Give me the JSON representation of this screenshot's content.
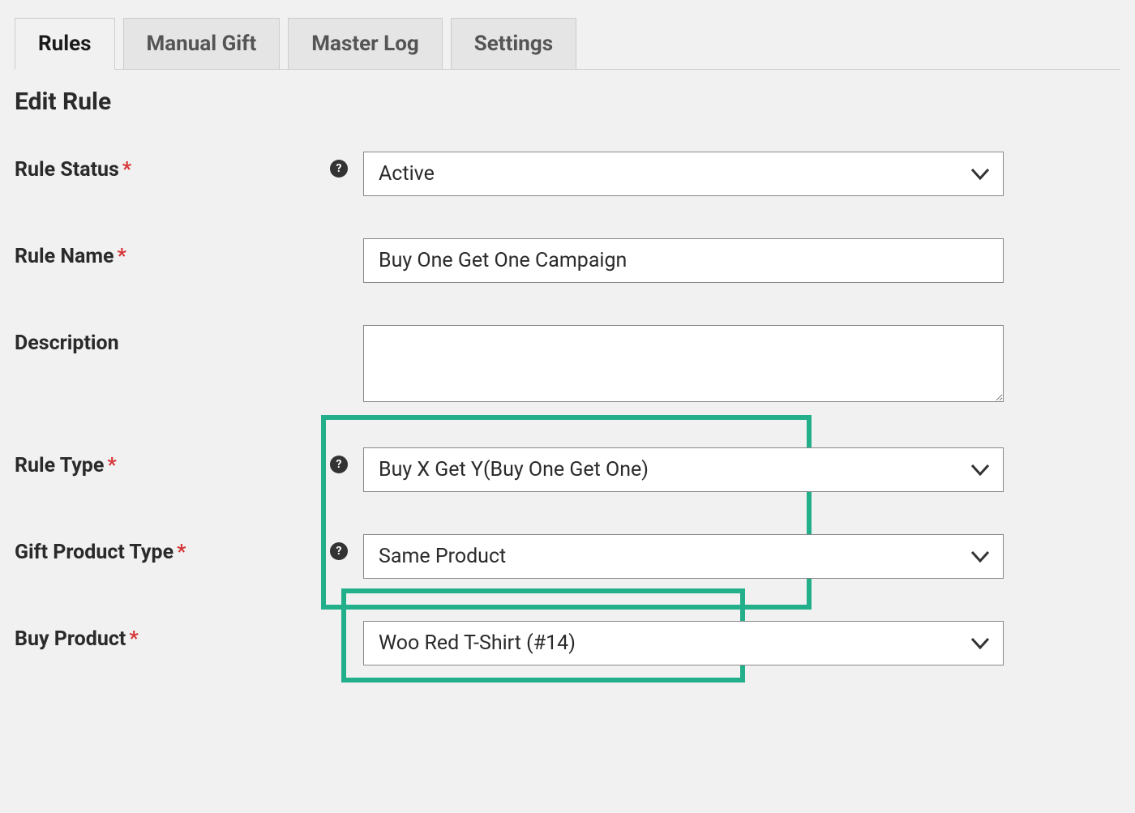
{
  "tabs": {
    "items": [
      {
        "label": "Rules",
        "active": true
      },
      {
        "label": "Manual Gift",
        "active": false
      },
      {
        "label": "Master Log",
        "active": false
      },
      {
        "label": "Settings",
        "active": false
      }
    ]
  },
  "heading": "Edit Rule",
  "form": {
    "rule_status": {
      "label": "Rule Status",
      "required": true,
      "has_help": true,
      "value": "Active"
    },
    "rule_name": {
      "label": "Rule Name",
      "required": true,
      "has_help": false,
      "value": "Buy One Get One Campaign"
    },
    "description": {
      "label": "Description",
      "required": false,
      "has_help": false,
      "value": ""
    },
    "rule_type": {
      "label": "Rule Type",
      "required": true,
      "has_help": true,
      "value": "Buy X Get Y(Buy One Get One)"
    },
    "gift_product_type": {
      "label": "Gift Product Type",
      "required": true,
      "has_help": true,
      "value": "Same Product"
    },
    "buy_product": {
      "label": "Buy Product",
      "required": true,
      "has_help": false,
      "value": "Woo Red T-Shirt (#14)"
    }
  },
  "icons": {
    "help_glyph": "?"
  }
}
